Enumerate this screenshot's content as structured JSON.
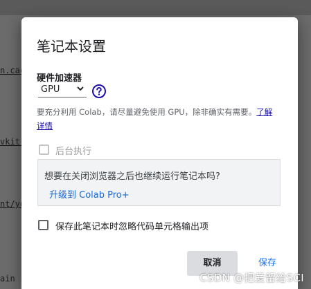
{
  "background": {
    "fragments": [
      "n.cac",
      "vkit.",
      "nt/yo",
      "ain"
    ]
  },
  "dialog": {
    "title": "笔记本设置",
    "hardware_label": "硬件加速器",
    "accelerator_value": "GPU",
    "hint_text": "要充分利用 Colab，请尽量避免使用 GPU，除非确实有需要。",
    "hint_link_1": "了解",
    "hint_link_2": "详情",
    "background_exec_label": "后台执行",
    "upsell_question": "想要在关闭浏览器之后也继续运行笔记本吗?",
    "upsell_link": "升级到 Colab Pro+",
    "omit_output_label": "保存此笔记本时忽略代码单元格输出项",
    "cancel_label": "取消",
    "save_label": "保存"
  },
  "watermark": "CSDN @把爱留给SCI",
  "colors": {
    "link_blue": "#1a73e8",
    "help_icon_blue": "#1a0dab",
    "backdrop": "#6b6b6b"
  }
}
